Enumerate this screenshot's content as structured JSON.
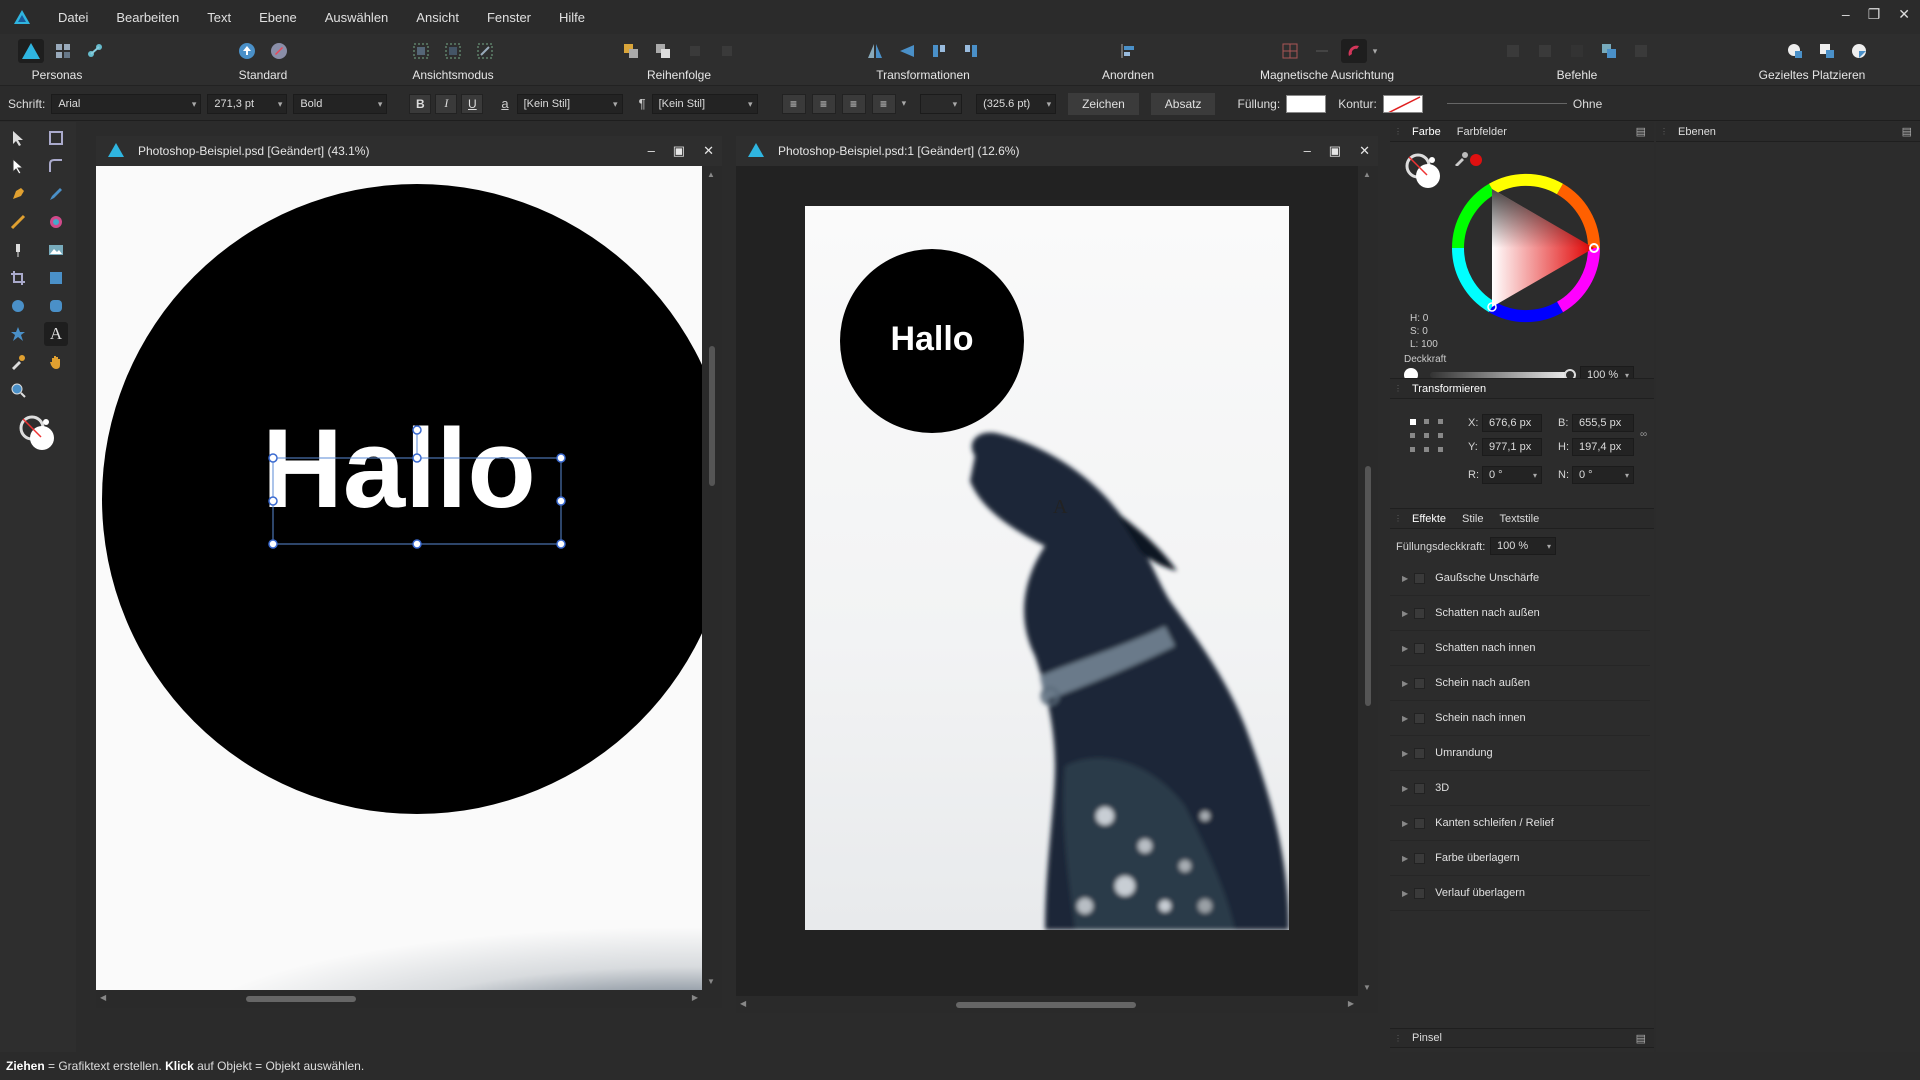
{
  "menubar": {
    "items": [
      "Datei",
      "Bearbeiten",
      "Text",
      "Ebene",
      "Auswählen",
      "Ansicht",
      "Fenster",
      "Hilfe"
    ]
  },
  "toolbar": {
    "groups": [
      {
        "label": "Personas"
      },
      {
        "label": "Standard"
      },
      {
        "label": "Ansichtsmodus"
      },
      {
        "label": "Reihenfolge"
      },
      {
        "label": "Transformationen"
      },
      {
        "label": "Anordnen"
      },
      {
        "label": "Magnetische Ausrichtung"
      },
      {
        "label": "Befehle"
      },
      {
        "label": "Gezieltes Platzieren"
      }
    ]
  },
  "context": {
    "font_label": "Schrift:",
    "font": "Arial",
    "size": "271,3 pt",
    "weight": "Bold",
    "bold": "B",
    "italic": "I",
    "underline": "U",
    "char_style_icon": "a",
    "char_style": "[Kein Stil]",
    "para_style_icon": "¶",
    "para_style": "[Kein Stil]",
    "leading": "(325.6 pt)",
    "zeichen": "Zeichen",
    "absatz": "Absatz",
    "fill_label": "Füllung:",
    "stroke_label": "Kontur:",
    "stroke_value": "Ohne"
  },
  "doc1": {
    "title": "Photoshop-Beispiel.psd [Geändert] (43.1%)",
    "text": "Hallo"
  },
  "doc2": {
    "title": "Photoshop-Beispiel.psd:1 [Geändert] (12.6%)",
    "text": "Hallo",
    "cursor": "A"
  },
  "color_panel": {
    "tab_color": "Farbe",
    "tab_swatches": "Farbfelder",
    "h": "H: 0",
    "s": "S: 0",
    "l": "L: 100",
    "opacity_label": "Deckkraft",
    "opacity": "100 %"
  },
  "layers_panel": {
    "tab": "Ebenen"
  },
  "transform": {
    "title": "Transformieren",
    "x_label": "X:",
    "x": "676,6 px",
    "y_label": "Y:",
    "y": "977,1 px",
    "w_label": "B:",
    "w": "655,5 px",
    "h_label": "H:",
    "h": "197,4 px",
    "r_label": "R:",
    "r": "0 °",
    "s_label": "N:",
    "s": "0 °"
  },
  "effects": {
    "tabs": [
      "Effekte",
      "Stile",
      "Textstile"
    ],
    "fill_opacity_label": "Füllungsdeckkraft:",
    "fill_opacity": "100 %",
    "items": [
      "Gaußsche Unschärfe",
      "Schatten nach außen",
      "Schatten nach innen",
      "Schein nach außen",
      "Schein nach innen",
      "Umrandung",
      "3D",
      "Kanten schleifen / Relief",
      "Farbe überlagern",
      "Verlauf überlagern"
    ]
  },
  "brush_panel": {
    "title": "Pinsel"
  },
  "status": {
    "b1": "Ziehen",
    "t1": " = Grafiktext erstellen. ",
    "b2": "Klick",
    "t2": " auf Objekt = Objekt auswählen."
  },
  "colors": {
    "accent": "#2fb5e0",
    "bg": "#2b2b2b",
    "selection": "#4a7fd4"
  }
}
